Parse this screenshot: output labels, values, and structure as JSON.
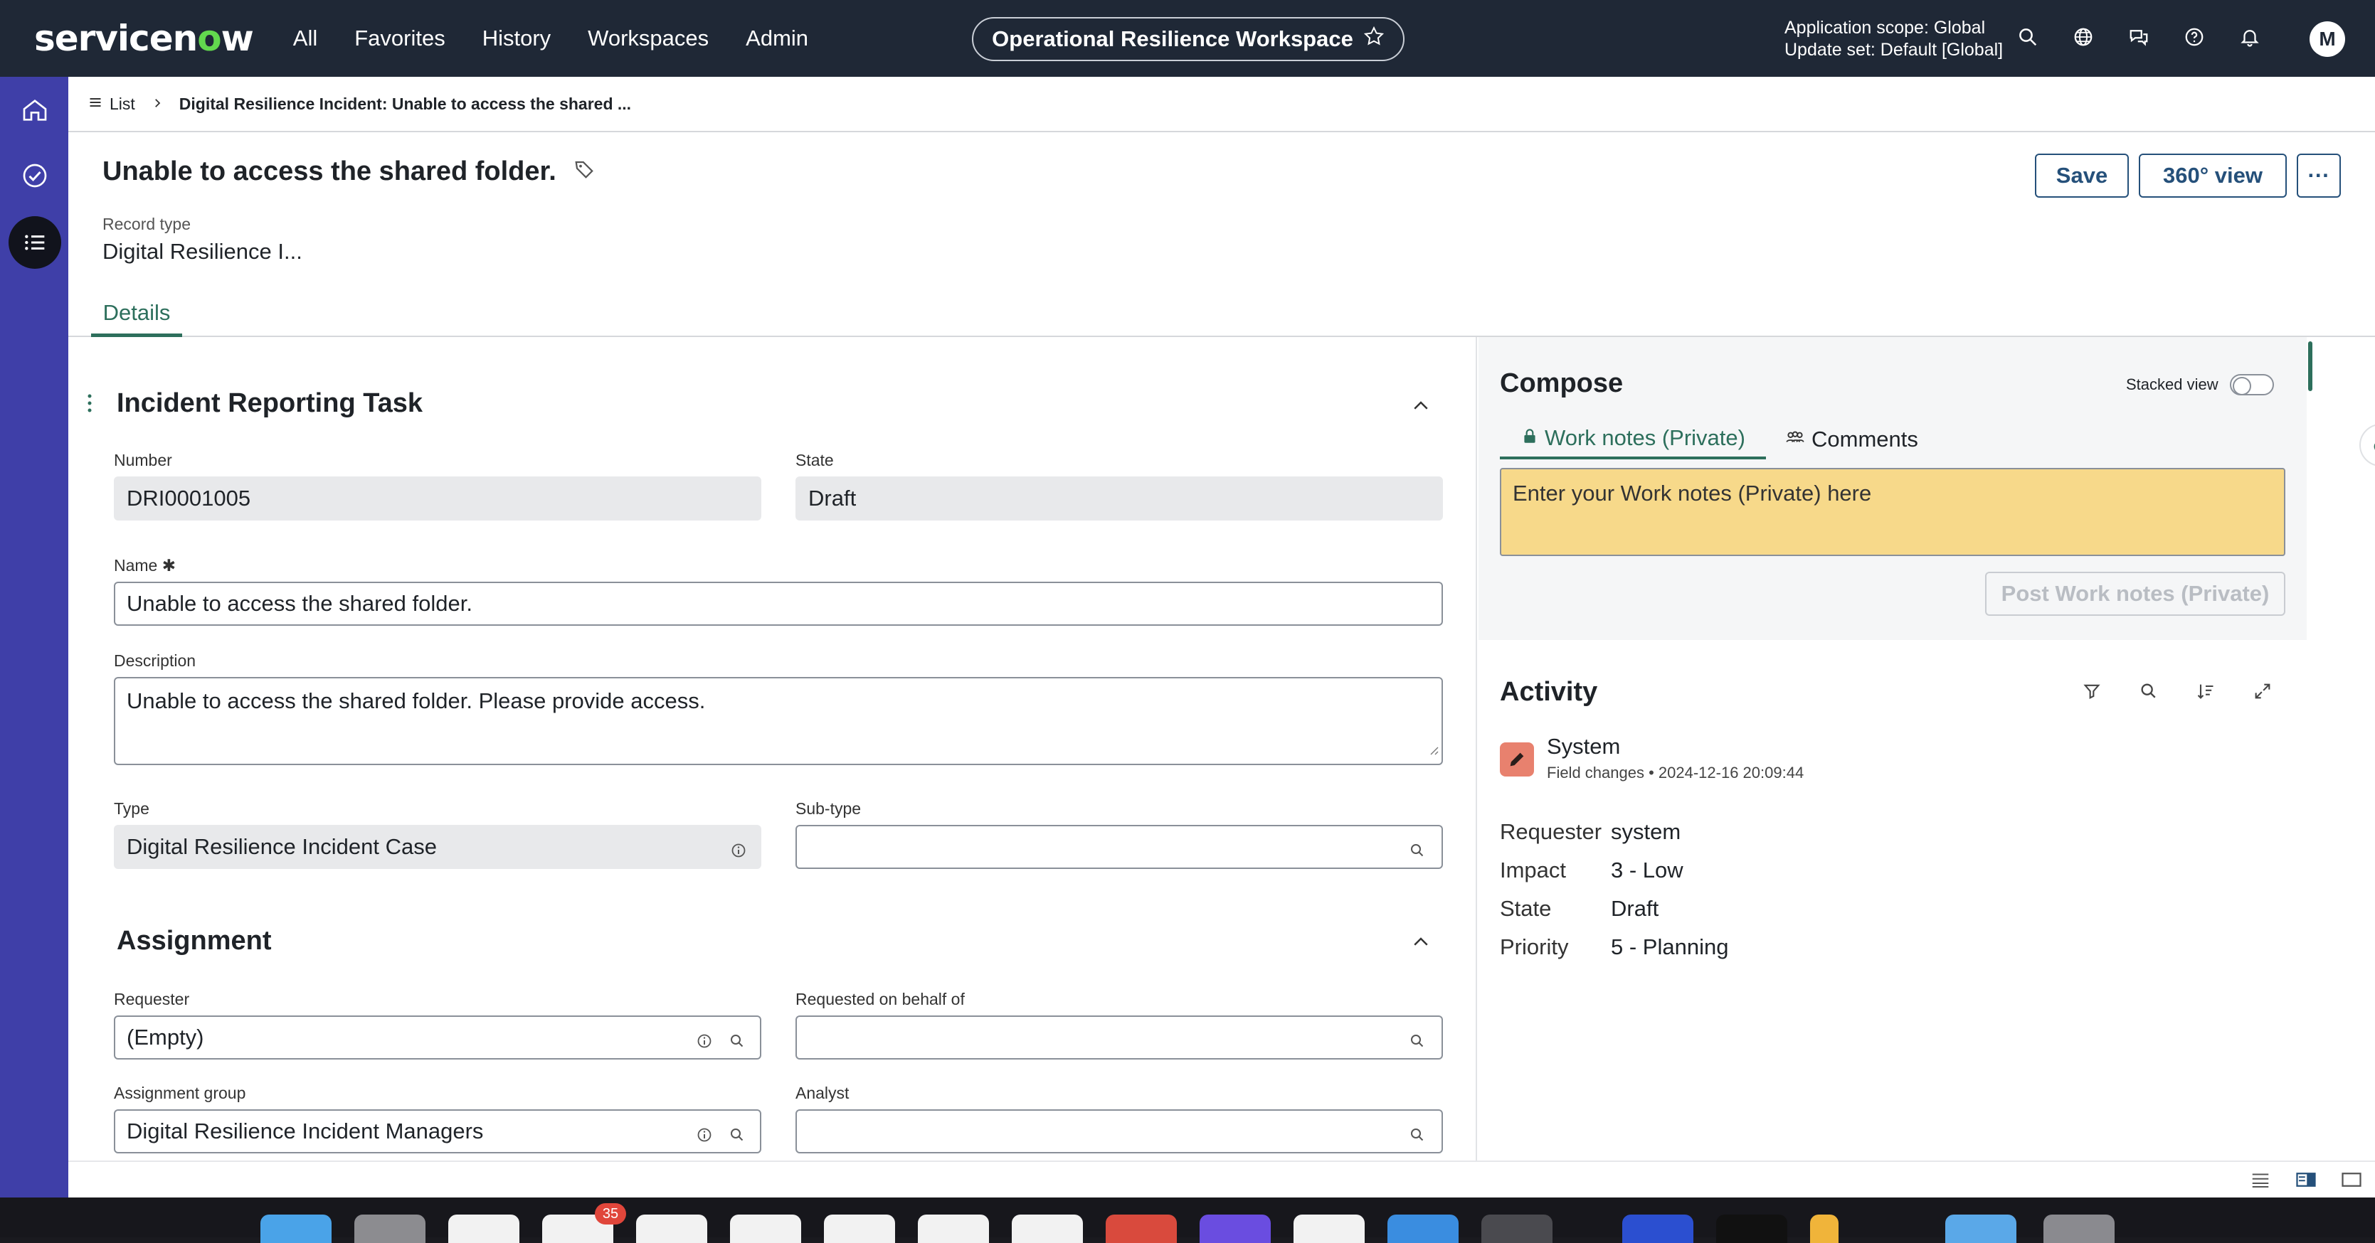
{
  "topbar": {
    "logo_pre": "servicen",
    "logo_o": "o",
    "logo_post": "w",
    "nav": [
      "All",
      "Favorites",
      "History",
      "Workspaces",
      "Admin"
    ],
    "workspace": "Operational Resilience Workspace",
    "scope_line1": "Application scope: Global",
    "scope_line2": "Update set: Default [Global]",
    "avatar": "M"
  },
  "breadcrumb": {
    "list_label": "List",
    "current": "Digital Resilience Incident: Unable to access the shared ..."
  },
  "header": {
    "title": "Unable to access the shared folder.",
    "record_type_label": "Record type",
    "record_type_value": "Digital Resilience I...",
    "tab": "Details",
    "save": "Save",
    "view360": "360° view",
    "more": "···"
  },
  "form": {
    "section1": "Incident Reporting Task",
    "number_label": "Number",
    "number_value": "DRI0001005",
    "state_label": "State",
    "state_value": "Draft",
    "name_label": "Name",
    "name_required": "✱",
    "name_value": "Unable to access the shared folder.",
    "description_label": "Description",
    "description_value": "Unable to access the shared folder. Please provide access.",
    "type_label": "Type",
    "type_value": "Digital Resilience Incident Case",
    "subtype_label": "Sub-type",
    "subtype_value": "",
    "section2": "Assignment",
    "requester_label": "Requester",
    "requester_value": "(Empty)",
    "behalf_label": "Requested on behalf of",
    "behalf_value": "",
    "group_label": "Assignment group",
    "group_value": "Digital Resilience Incident Managers",
    "analyst_label": "Analyst",
    "analyst_value": ""
  },
  "compose": {
    "title": "Compose",
    "stacked_label": "Stacked view",
    "tab_worknotes": "Work notes (Private)",
    "tab_comments": "Comments",
    "input_placeholder": "Enter your Work notes (Private) here",
    "post_button": "Post Work notes (Private)"
  },
  "activity": {
    "title": "Activity",
    "entry_user": "System",
    "entry_meta": "Field changes • 2024-12-16 20:09:44",
    "changes": [
      {
        "key": "Requester",
        "value": "system"
      },
      {
        "key": "Impact",
        "value": "3 - Low"
      },
      {
        "key": "State",
        "value": "Draft"
      },
      {
        "key": "Priority",
        "value": "5 - Planning"
      }
    ]
  },
  "dock": {
    "badge": "35"
  },
  "colors": {
    "topbar": "#1f2836",
    "rail": "#3f3fa8",
    "accent_green": "#2d6f5c",
    "worknote_bg": "#f7d98a"
  }
}
